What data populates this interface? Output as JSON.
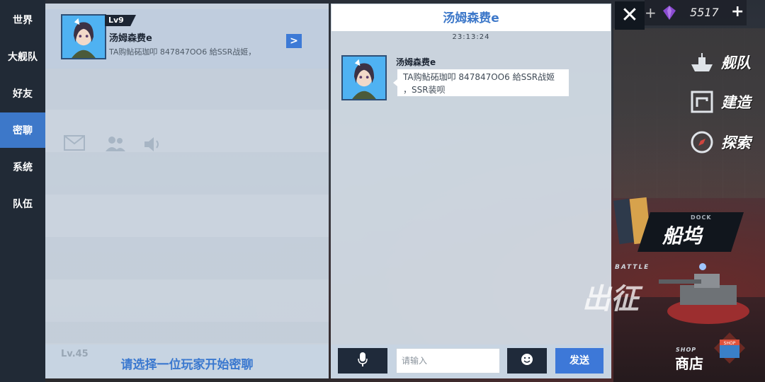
{
  "side_tabs": [
    {
      "label": "世界"
    },
    {
      "label": "大舰队"
    },
    {
      "label": "好友"
    },
    {
      "label": "密聊"
    },
    {
      "label": "系统"
    },
    {
      "label": "队伍"
    }
  ],
  "contact": {
    "level": "Lv9",
    "name": "汤姆森费e",
    "preview": "TA购鲇砳珈叩 847847OO6 給SSR战姬，",
    "arrow": ">"
  },
  "list_background": {
    "ghost_level": "Lv.45"
  },
  "list_hint": "请选择一位玩家开始密聊",
  "chat": {
    "title": "汤姆森费e",
    "timestamp": "23:13:24",
    "sender_name": "汤姆森费e",
    "message_line1": "TA购鲇砳珈叩 847847OO6 給SSR战姬",
    "message_line2": "，SSR装呗",
    "input_placeholder": "请输入",
    "send_label": "发送"
  },
  "hud": {
    "close_symbol": "✕",
    "currency_value": "5517",
    "currency_plus": "+",
    "menu": [
      {
        "label": "舰队"
      },
      {
        "label": "建造"
      },
      {
        "label": "探索"
      }
    ],
    "dock_en": "DOCK",
    "dock_label": "船坞",
    "battle_en": "BATTLE",
    "sortie_label": "出征",
    "shop_en": "SHOP",
    "shop_label": "商店",
    "shop_sign": "SHOP"
  },
  "colors": {
    "accent_blue": "#3d78c9",
    "tab_bar": "#212a36",
    "dark_button": "#1f2a3a",
    "panel_bg": "#d6e0ea"
  },
  "icons": [
    "microphone-icon",
    "emoji-icon",
    "close-icon",
    "gem-icon",
    "chevron-right-icon",
    "fleet-icon",
    "build-icon",
    "explore-icon",
    "mail-icon",
    "friends-icon",
    "sound-icon"
  ]
}
